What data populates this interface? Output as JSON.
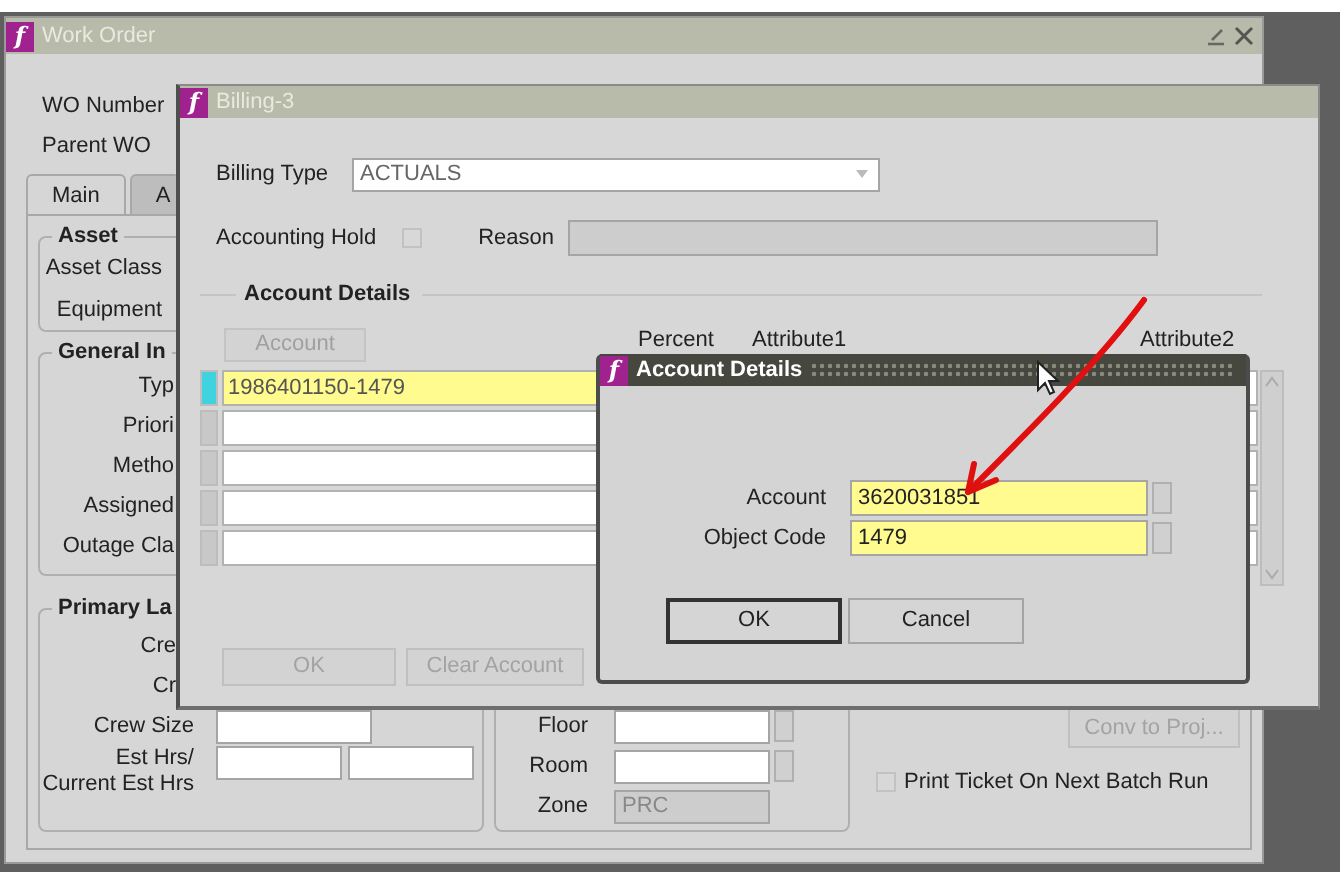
{
  "work_order": {
    "logo": "f",
    "title": "Work Order",
    "header_fields": [
      {
        "label": "WO Number"
      },
      {
        "label": "Parent WO"
      }
    ],
    "tabs": [
      {
        "label": "Main",
        "selected": true
      },
      {
        "label": "A",
        "selected": false
      }
    ],
    "asset_group": {
      "title": "Asset",
      "labels": [
        "Asset Class",
        "Equipment"
      ]
    },
    "general_group": {
      "title": "General In",
      "labels": [
        "Typ",
        "Priori",
        "Metho",
        "Assigned",
        "Outage Cla"
      ]
    },
    "labor_group": {
      "title": "Primary La",
      "rows": [
        {
          "label": "Cre",
          "kind": "label_only"
        },
        {
          "label": "Cr",
          "kind": "label_only"
        },
        {
          "label": "Crew Size",
          "kind": "single_field"
        },
        {
          "label": "Est Hrs/",
          "label2": "Current Est Hrs",
          "kind": "double_field"
        }
      ]
    },
    "location_group": {
      "rows": [
        {
          "label": "Floor",
          "lookup": true
        },
        {
          "label": "Room",
          "lookup": true
        },
        {
          "label": "Zone",
          "value": "PRC",
          "disabled": true
        }
      ]
    },
    "conv_button": {
      "label": "Conv to Proj...",
      "disabled": true
    },
    "print_ticket": {
      "label": "Print Ticket On Next Batch Run",
      "checked": false
    }
  },
  "billing": {
    "logo": "f",
    "title": "Billing-3",
    "billing_type": {
      "label": "Billing Type",
      "value": "ACTUALS"
    },
    "accounting_hold": {
      "label": "Accounting Hold",
      "checked": false
    },
    "reason": {
      "label": "Reason",
      "disabled": true
    },
    "section_title": "Account Details",
    "columns": [
      {
        "label": "Account",
        "kind": "button"
      },
      {
        "label": "Percent",
        "kind": "text"
      },
      {
        "label": "Attribute1",
        "kind": "text"
      },
      {
        "label": "Attribute2",
        "kind": "text"
      }
    ],
    "rows": [
      {
        "account": "1986401150-1479",
        "selected": true
      },
      {
        "selected": false
      },
      {
        "selected": false
      },
      {
        "selected": false
      },
      {
        "selected": false
      }
    ],
    "buttons": [
      {
        "label": "OK",
        "disabled": true
      },
      {
        "label": "Clear Account",
        "disabled": true
      }
    ]
  },
  "account_dialog": {
    "logo": "f",
    "title": "Account Details",
    "fields": [
      {
        "label": "Account",
        "value": "3620031851"
      },
      {
        "label": "Object Code",
        "value": "1479"
      }
    ],
    "buttons": [
      {
        "label": "OK",
        "default": true
      },
      {
        "label": "Cancel",
        "default": false
      }
    ]
  }
}
